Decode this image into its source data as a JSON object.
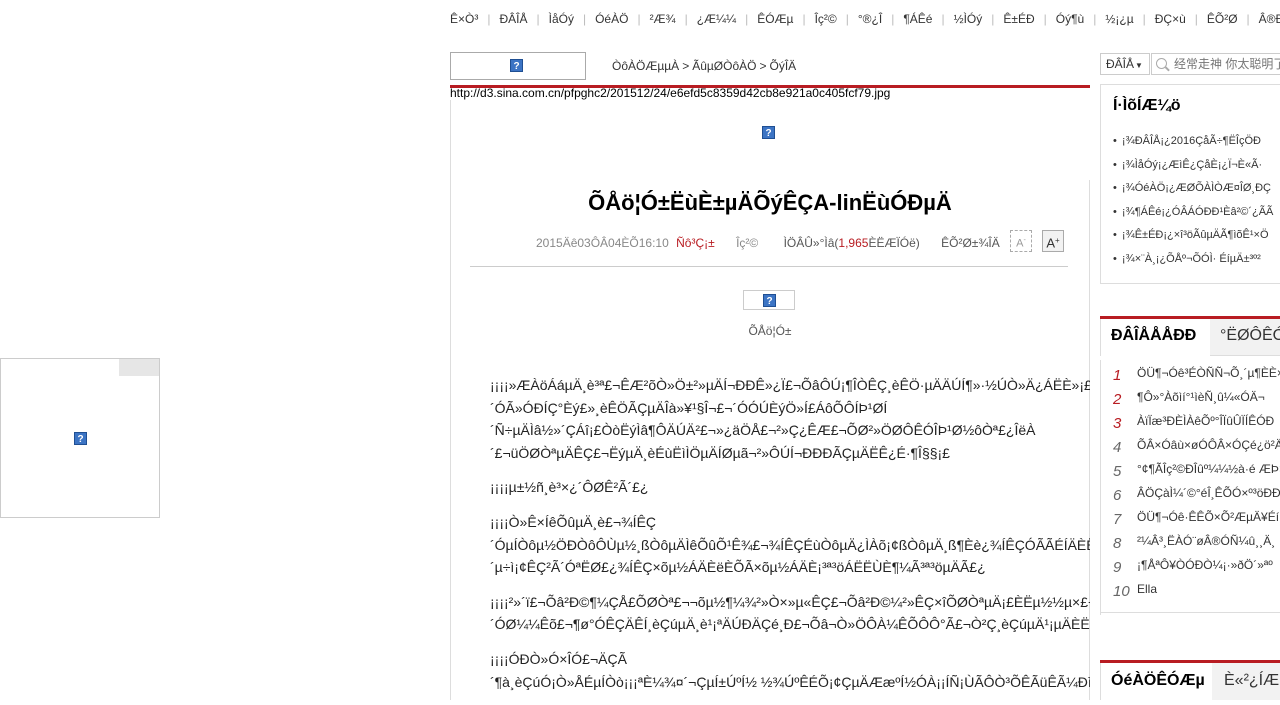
{
  "topnav": [
    "Ê×Ò³",
    "ÐÂÎÅ",
    "ÌåÓý",
    "ÓéÀÖ",
    "²Æ¾­",
    "¿Æ¼¼",
    "ÊÓÆµ",
    "Îç²©",
    "°®¿Î",
    "¶ÁÊé",
    "½ÌÓý",
    "Ê±ÉÐ",
    "Óý¶ù",
    "½¡¿µ",
    "ÐÇ×ù",
    "ÊÕ²Ø",
    "Â®ÐÂ",
    "Æû³µ"
  ],
  "breadcrumb": {
    "home": "ÒôÀÖÆµµÀ",
    "section": "ÃûµØÒôÀÖ",
    "current": "ÕýÎÄ",
    "separator": ">"
  },
  "image_url": "http://d3.sina.com.cn/pfpghc2/201512/24/e6efd5c8359d42cb8e921a0c405fcf79.jpg",
  "article": {
    "title": "ÕÅö¦Ó±ËùÈ±µÄÕýÊÇA-linËùÓÐµÄ",
    "date": "2015Äê03ÔÂ04ÈÕ16:10",
    "source": "Ñô³Ç¡±",
    "comment_prefix": "Îç²©",
    "comment_label": "ÌÖÂÛ»°Ìâ(",
    "comment_count": "1,965",
    "comment_suffix": "ÈËÆÏÓë)",
    "share_label": "ÊÕ²Ø±¾ÎÄ",
    "font_small": "A",
    "font_large": "A",
    "image_caption": "ÕÅö¦Ó±",
    "paragraphs": [
      "¡¡¡¡»ÆÀöÁáµÄ¸è³ª£¬ÊÆ²õÒ»Ö±²»µÄÍ¬ÐÐÊ»¿Ï£¬ÕâÔÚ¡¶ÎÒÊÇ¸èÊÖ·µÄÄÚÍ¶»·½ÚÒ»Ä¿ÁËÈ»¡£",
      "´ÓÃ»ÓÐÍÇ°Èý£»¸èÊÖÃÇµÄÎà»¥¹§Î¬£¬´ÓÓÚÈýÖ»Í£ÁôÕÔÍÞ¹ØÍ",
      "´Ñ÷µÄÌâ½»´ÇÁî¡£ÒòËýÌâ¶ÔÄÚÄ²£¬»¿äÖÅ£¬²»Ç¿ÊÆ£¬ÕØ²»ÖØÔÊÓÎÞ¹Ø½ôÒª£¿ÎëÀ",
      "´£¬üÖØÒªµÄÊÇ£¬ËýµÄ¸èÉùËìÌÖµÄÍØµã¬²»ÔÚÍ¬ÐÐÐÃÇµÄËÊ¿É·¶Î§§¡£"
    ],
    "p2": "¡¡¡¡µ±½ñ¸è³×¿´ÔØÊ²Ã´£¿",
    "p3": [
      "¡¡¡¡Ò»Ê×ÍêÕûµÄ¸è£¬¾ÍÊÇ",
      "´ÓµÍÒôµ½ÖÐÒôÔÙµ½¸ßÒôµÄÌêÕûÕ¹Ê¾£¬¾ÍÊÇÉùÒôµÄ¿ÌÀõ¡¢ßÒôµÄ¸ß¶Èè¿¾ÍÊÇÓÃÃÉÍÄÈËÃ",
      "´µ÷ì¡¢ÊÇ²Ã´ÓªËØ£¿¾ÍÊÇ×õµ½ÁÄÈëÈÕÃ×õµ½ÁÄÈ¡³ª³öÁËËÙÈ¶¼Ã³ª³öµÄÃ£¿"
    ],
    "p4": [
      "¡¡¡¡²»´ï£¬Õâ²Ð©¶¼ÇÅ£ÕØÒª£¬¬õµ½¶¼¾²»Ò×»µ«ÊÇ£¬Õâ²Ð©¼²»ÊÇ×îÕØÒªµÄ¡£ÈËµ½½µ×£¬Õâ",
      "´ÓØ¼¼Êõ£¬¶ø°ÓÊÇÄÊÍ¸èÇúµÄ¸è¹¡ªÄÚÐÄÇé¸Ð£¬Õâ¬Ò»ÖÔÀ¼ÊÕÔÔ°Ã£¬Ò²Ç¸èÇúµÄ¹¡µÄÈË±"
    ],
    "p5": "¡¡¡¡ÓÐÒ»Ó×ÎÓ£¬ÄÇÃ",
    "p6": "´¶à¸èÇúÓ¡Ò»ÅÉµÍÒò¡¡¡ªÈ¼¾¤´¬ÇµÍ±ÚºÍ½ ½¾ÚºÊÉÕ¡¢ÇµÄÆæºÍ½ÓÀ¡¡ÍÑ¡ÙÃÔÒ³ÕÊÃüÊÃ¼ÐìÜ"
  },
  "search": {
    "engine": "ÐÂÎÅ",
    "placeholder": "经常走神 你太聪明了"
  },
  "related": {
    "title": "Í·ÌõÍÆ¼ö",
    "items": [
      "¡¾ÐÂÎÅ¡¿2016ÇåÃ÷¶ËÎçÖÐ",
      "¡¾ÌåÓý¡¿ÆìÊ¿ÇåÈ¡¿Ï¬È«Ã·",
      "¡¾ÓéÀÖ¡¿ÆØÕÀÌÒÆ¤ÎØ¸ÐÇ",
      "¡¾¶ÁÊé¡¿ÓÂÁÓÐÐ¹Èâ²©´¿ÃÃ",
      "¡¾Ê±ÉÐ¡¿×î³öÃûµÄÃ¶ìõÊ¹×Ö",
      "¡¾×¨À¸¡¿ÕÅº¬ÕÓÌ· ÉíµÄ±³º²"
    ]
  },
  "ranking": {
    "tab_active": "ÐÂÎÅÅÅÐÐ",
    "tab_other": "°ËØÔÊÓ",
    "items": [
      {
        "n": "1",
        "t": "ÖÜ¶¬Óê³ÉÒÑÑ¬Õ¸´µ¶ÈÈ×ÎÉÏ"
      },
      {
        "n": "2",
        "t": "¶Ô»°Àõìí°¹ìèÑ¸û¼«ÓÄ¬"
      },
      {
        "n": "3",
        "t": "ÀïÏæ³ÐÈÌÀêÕº°ÎÏûÛÏÍÊÓÐ"
      },
      {
        "n": "4",
        "t": "ÕÂ×Óâù×øÓÔÂ×ÓÇé¿ö²Ä Ì"
      },
      {
        "n": "5",
        "t": "°¢¶ÃÎç²©ÐÎûº¼¼½à·é ÆÞ×"
      },
      {
        "n": "6",
        "t": "ÂÖÇàÌ¼´©°éÎ¸ÊÕÓ×º³öÐÐ Ç"
      },
      {
        "n": "7",
        "t": "ÖÜ¶¬Óê·ÊÊÕ×Õ²ÆµÄ¥Éí Á"
      },
      {
        "n": "8",
        "t": "²¼Â³¸ËÀÓ¨øÂ®ÓÑ¼û¸¸Ä¸"
      },
      {
        "n": "9",
        "t": "¡¶ÅªÔ¥ÒÓÐÒ¼¡·»ðÖ´»ªº"
      },
      {
        "n": "10",
        "t": "Ella"
      }
    ]
  },
  "category": {
    "tab_active": "ÓéÀÖÊÓÆµ",
    "tab_other": "È«²¿ÍÆ"
  },
  "colors": {
    "accent_red": "#b81c22",
    "link_blue": "#3c74c4"
  },
  "icons": {
    "broken_image": "question-mark-box-icon",
    "search": "magnifier-icon",
    "dropdown": "triangle-down-icon"
  }
}
